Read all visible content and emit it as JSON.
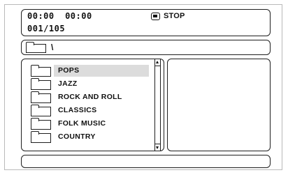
{
  "status": {
    "time_display": "00:00  00:00",
    "track_display": "001/105",
    "mode_icon": "stop-icon",
    "mode_label": "STOP"
  },
  "path": {
    "icon": "folder-icon",
    "current": "\\"
  },
  "folders": [
    {
      "label": "POPS",
      "selected": true
    },
    {
      "label": "JAZZ",
      "selected": false
    },
    {
      "label": "ROCK AND ROLL",
      "selected": false
    },
    {
      "label": "CLASSICS",
      "selected": false
    },
    {
      "label": "FOLK MUSIC",
      "selected": false
    },
    {
      "label": "COUNTRY",
      "selected": false
    }
  ],
  "scrollbar": {
    "up_icon": "scroll-up-arrow-icon",
    "down_icon": "scroll-down-arrow-icon"
  },
  "colors": {
    "border": "#1e1e1e",
    "selection": "#dcdcdc",
    "background": "#ffffff"
  }
}
